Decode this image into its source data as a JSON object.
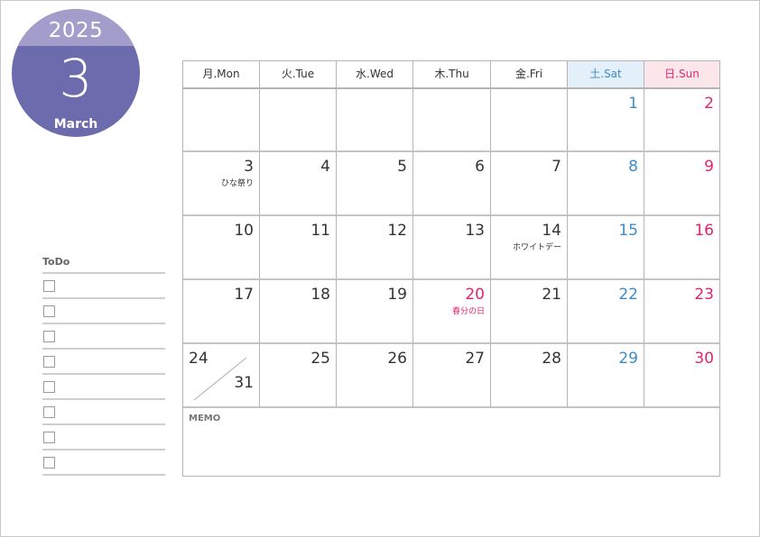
{
  "header": {
    "year": "2025",
    "month_number": "3",
    "month_name": "March"
  },
  "colors": {
    "badge_dark": "#6b6bae",
    "badge_light": "#a29dca",
    "saturday": "#3d8bc9",
    "sunday_holiday": "#e2246e",
    "saturday_header_bg": "#e3f0fa",
    "sunday_header_bg": "#fbe7ea"
  },
  "todo": {
    "title": "ToDo",
    "items": [
      "",
      "",
      "",
      "",
      "",
      "",
      "",
      ""
    ]
  },
  "calendar": {
    "weekdays": [
      "月.Mon",
      "火.Tue",
      "水.Wed",
      "木.Thu",
      "金.Fri",
      "土.Sat",
      "日.Sun"
    ],
    "weeks": [
      [
        {
          "day": ""
        },
        {
          "day": ""
        },
        {
          "day": ""
        },
        {
          "day": ""
        },
        {
          "day": ""
        },
        {
          "day": "1"
        },
        {
          "day": "2"
        }
      ],
      [
        {
          "day": "3",
          "note": "ひな祭り"
        },
        {
          "day": "4"
        },
        {
          "day": "5"
        },
        {
          "day": "6"
        },
        {
          "day": "7"
        },
        {
          "day": "8"
        },
        {
          "day": "9"
        }
      ],
      [
        {
          "day": "10"
        },
        {
          "day": "11"
        },
        {
          "day": "12"
        },
        {
          "day": "13"
        },
        {
          "day": "14",
          "note": "ホワイトデー"
        },
        {
          "day": "15"
        },
        {
          "day": "16"
        }
      ],
      [
        {
          "day": "17"
        },
        {
          "day": "18"
        },
        {
          "day": "19"
        },
        {
          "day": "20",
          "note": "春分の日",
          "holiday": true
        },
        {
          "day": "21"
        },
        {
          "day": "22"
        },
        {
          "day": "23"
        }
      ],
      [
        {
          "day": "24",
          "day_split": "31"
        },
        {
          "day": "25"
        },
        {
          "day": "26"
        },
        {
          "day": "27"
        },
        {
          "day": "28"
        },
        {
          "day": "29"
        },
        {
          "day": "30"
        }
      ]
    ],
    "memo_label": "MEMO"
  }
}
